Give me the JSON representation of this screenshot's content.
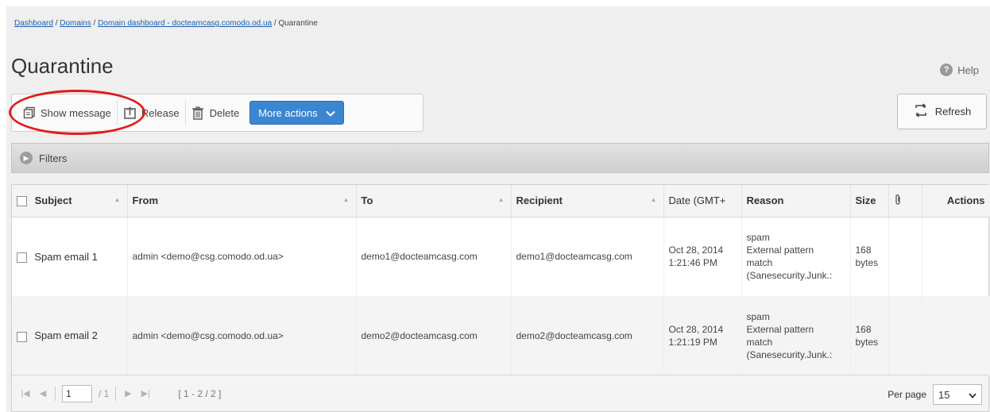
{
  "breadcrumb": {
    "items": [
      "Dashboard",
      "Domains",
      "Domain dashboard - docteamcasg.comodo.od.ua"
    ],
    "current": "Quarantine",
    "separator": "/"
  },
  "page_title": "Quarantine",
  "help_label": "Help",
  "toolbar": {
    "show_message": "Show message",
    "release": "Release",
    "delete": "Delete",
    "more_actions": "More actions"
  },
  "refresh_label": "Refresh",
  "filters_label": "Filters",
  "table": {
    "columns": {
      "subject": "Subject",
      "from": "From",
      "to": "To",
      "recipient": "Recipient",
      "date": "Date (GMT+",
      "reason": "Reason",
      "size": "Size",
      "actions": "Actions"
    },
    "rows": [
      {
        "subject": "Spam email 1",
        "from": "admin <demo@csg.comodo.od.ua>",
        "to": "demo1@docteamcasg.com",
        "recipient": "demo1@docteamcasg.com",
        "date": "Oct 28, 2014",
        "time": "1:21:46 PM",
        "reason_1": "spam",
        "reason_2": "External pattern",
        "reason_3": "match",
        "reason_4": "(Sanesecurity.Junk.:",
        "size_value": "168",
        "size_unit": "bytes"
      },
      {
        "subject": "Spam email 2",
        "from": "admin <demo@csg.comodo.od.ua>",
        "to": "demo2@docteamcasg.com",
        "recipient": "demo2@docteamcasg.com",
        "date": "Oct 28, 2014",
        "time": "1:21:19 PM",
        "reason_1": "spam",
        "reason_2": "External pattern",
        "reason_3": "match",
        "reason_4": "(Sanesecurity.Junk.:",
        "size_value": "168",
        "size_unit": "bytes"
      }
    ]
  },
  "pager": {
    "page": "1",
    "of_pages": "/ 1",
    "range": "[ 1 - 2 / 2 ]",
    "per_page_label": "Per page",
    "per_page_value": "15"
  },
  "colors": {
    "primary_button": "#3b86d1",
    "highlight_ring": "#e21c1c",
    "link": "#1a5fb4"
  }
}
